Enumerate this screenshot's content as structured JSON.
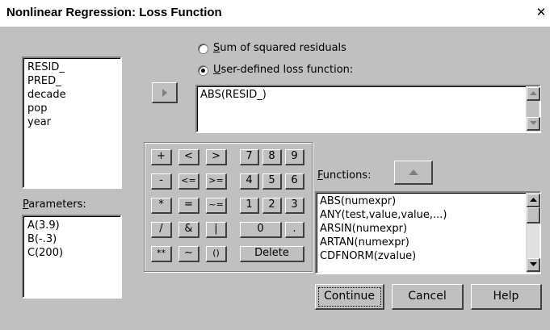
{
  "window": {
    "title": "Nonlinear Regression: Loss Function"
  },
  "variables": [
    "RESID_",
    "PRED_",
    "decade",
    "pop",
    "year"
  ],
  "parameters": {
    "label": "Parameters:",
    "items": [
      "A(3.9)",
      "B(-.3)",
      "C(200)"
    ]
  },
  "loss_options": [
    {
      "label": "Sum of squared residuals",
      "selected": false
    },
    {
      "label": "User-defined loss function:",
      "selected": true
    }
  ],
  "expression": "ABS(RESID_)",
  "keypad": {
    "rows": [
      [
        "+",
        "<",
        ">",
        "7",
        "8",
        "9"
      ],
      [
        "-",
        "<=",
        ">=",
        "4",
        "5",
        "6"
      ],
      [
        "*",
        "=",
        "~=",
        "1",
        "2",
        "3"
      ],
      [
        "/",
        "&",
        "|",
        "0",
        "."
      ],
      [
        "**",
        "~",
        "()",
        "Delete"
      ]
    ]
  },
  "functions": {
    "label": "Functions:",
    "items": [
      "ABS(numexpr)",
      "ANY(test,value,value,...)",
      "ARSIN(numexpr)",
      "ARTAN(numexpr)",
      "CDFNORM(zvalue)"
    ]
  },
  "buttons": {
    "continue": "Continue",
    "cancel": "Cancel",
    "help": "Help"
  }
}
